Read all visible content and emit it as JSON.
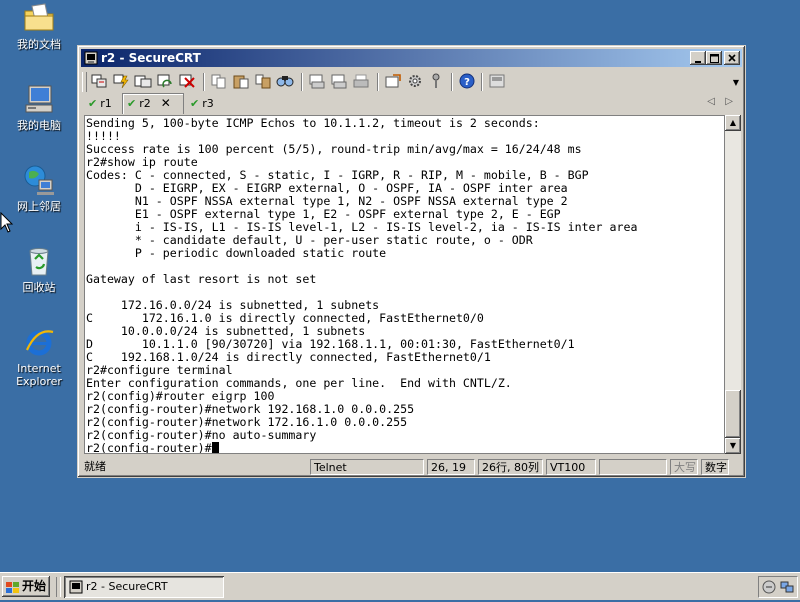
{
  "desktop": {
    "icons": [
      {
        "label": "我的文档",
        "icon": "my-documents-icon"
      },
      {
        "label": "我的电脑",
        "icon": "my-computer-icon"
      },
      {
        "label": "网上邻居",
        "icon": "network-places-icon"
      },
      {
        "label": "回收站",
        "icon": "recycle-bin-icon"
      },
      {
        "label": "Internet\nExplorer",
        "icon": "internet-explorer-icon"
      }
    ]
  },
  "window": {
    "title": "r2 - SecureCRT",
    "tabs": [
      {
        "label": "r1",
        "active": false
      },
      {
        "label": "r2",
        "active": true
      },
      {
        "label": "r3",
        "active": false
      }
    ],
    "terminal_lines": [
      "Sending 5, 100-byte ICMP Echos to 10.1.1.2, timeout is 2 seconds:",
      "!!!!!",
      "Success rate is 100 percent (5/5), round-trip min/avg/max = 16/24/48 ms",
      "r2#show ip route",
      "Codes: C - connected, S - static, I - IGRP, R - RIP, M - mobile, B - BGP",
      "       D - EIGRP, EX - EIGRP external, O - OSPF, IA - OSPF inter area",
      "       N1 - OSPF NSSA external type 1, N2 - OSPF NSSA external type 2",
      "       E1 - OSPF external type 1, E2 - OSPF external type 2, E - EGP",
      "       i - IS-IS, L1 - IS-IS level-1, L2 - IS-IS level-2, ia - IS-IS inter area",
      "       * - candidate default, U - per-user static route, o - ODR",
      "       P - periodic downloaded static route",
      "",
      "Gateway of last resort is not set",
      "",
      "     172.16.0.0/24 is subnetted, 1 subnets",
      "C       172.16.1.0 is directly connected, FastEthernet0/0",
      "     10.0.0.0/24 is subnetted, 1 subnets",
      "D       10.1.1.0 [90/30720] via 192.168.1.1, 00:01:30, FastEthernet0/1",
      "C    192.168.1.0/24 is directly connected, FastEthernet0/1",
      "r2#configure terminal",
      "Enter configuration commands, one per line.  End with CNTL/Z.",
      "r2(config)#router eigrp 100",
      "r2(config-router)#network 192.168.1.0 0.0.0.255",
      "r2(config-router)#network 172.16.1.0 0.0.0.255",
      "r2(config-router)#no auto-summary",
      "r2(config-router)#"
    ],
    "status": {
      "ready": "就绪",
      "protocol": "Telnet",
      "cursor_pos": "26, 19",
      "size": "26行, 80列",
      "emulation": "VT100",
      "caps": "大写",
      "num": "数字"
    }
  },
  "taskbar": {
    "start_label": "开始",
    "task_label": "r2 - SecureCRT"
  },
  "colors": {
    "desktop": "#3a6ea5",
    "title_start": "#0a246a",
    "title_end": "#a6caf0",
    "chrome": "#d4d0c8"
  }
}
